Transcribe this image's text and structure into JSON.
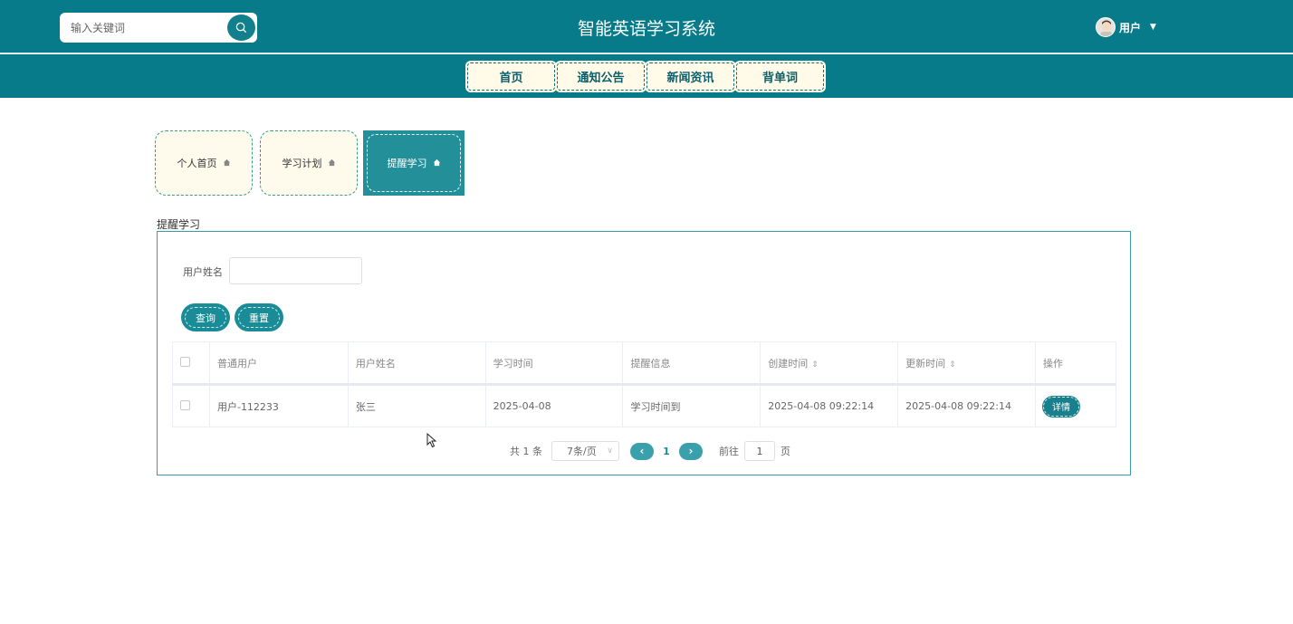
{
  "header": {
    "search_placeholder": "输入关键词",
    "title": "智能英语学习系统",
    "user_label": "用户"
  },
  "nav": {
    "items": [
      {
        "label": "首页"
      },
      {
        "label": "通知公告"
      },
      {
        "label": "新闻资讯"
      },
      {
        "label": "背单词"
      }
    ]
  },
  "tabs": [
    {
      "label": "个人首页",
      "active": false
    },
    {
      "label": "学习计划",
      "active": false
    },
    {
      "label": "提醒学习",
      "active": true
    }
  ],
  "section": {
    "label": "提醒学习"
  },
  "filter": {
    "label": "用户姓名",
    "value": ""
  },
  "buttons": {
    "query": "查询",
    "reset": "重置"
  },
  "table": {
    "columns": [
      "普通用户",
      "用户姓名",
      "学习时间",
      "提醒信息",
      "创建时间",
      "更新时间",
      "操作"
    ],
    "rows": [
      {
        "user": "用户-112233",
        "name": "张三",
        "study_time": "2025-04-08",
        "reminder": "学习时间到",
        "created": "2025-04-08 09:22:14",
        "updated": "2025-04-08 09:22:14",
        "action": "详情"
      }
    ]
  },
  "pagination": {
    "total": "共 1 条",
    "page_size": "7条/页",
    "current_page": "1",
    "goto_label": "前往",
    "goto_value": "1",
    "page_suffix": "页"
  },
  "colors": {
    "brand": "#077b8a",
    "accent": "#1a8c97",
    "tab_bg": "#fefbed"
  }
}
